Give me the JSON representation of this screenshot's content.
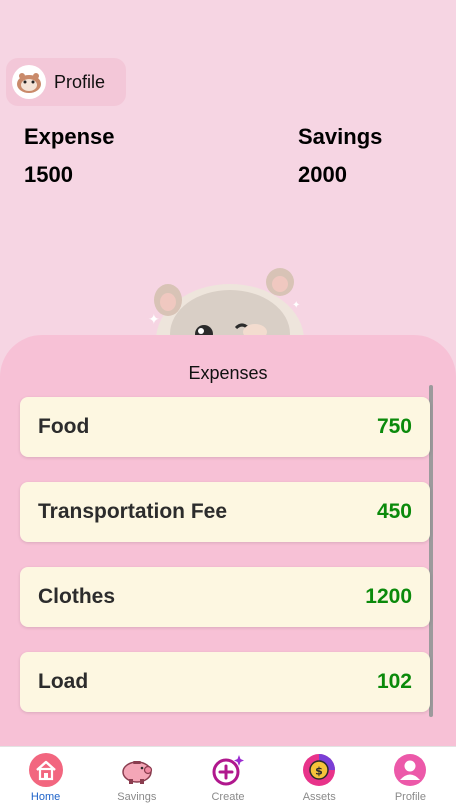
{
  "profile": {
    "label": "Profile"
  },
  "summary": {
    "expense_label": "Expense",
    "expense_value": "1500",
    "savings_label": "Savings",
    "savings_value": "2000"
  },
  "expenses": {
    "title": "Expenses",
    "items": [
      {
        "name": "Food",
        "amount": "750"
      },
      {
        "name": "Transportation Fee",
        "amount": "450"
      },
      {
        "name": "Clothes",
        "amount": "1200"
      },
      {
        "name": "Load",
        "amount": "102"
      }
    ]
  },
  "nav": {
    "items": [
      {
        "label": "Home",
        "icon": "home-icon"
      },
      {
        "label": "Savings",
        "icon": "piggy-bank-icon"
      },
      {
        "label": "Create",
        "icon": "plus-sparkle-icon"
      },
      {
        "label": "Assets",
        "icon": "coin-chart-icon"
      },
      {
        "label": "Profile",
        "icon": "user-icon"
      }
    ],
    "active": "Home"
  },
  "colors": {
    "background": "#f6d5e3",
    "panel": "#f7c1d6",
    "card": "#fdf7e1",
    "amount": "#0b8a0b",
    "nav_active": "#1d62c9"
  }
}
